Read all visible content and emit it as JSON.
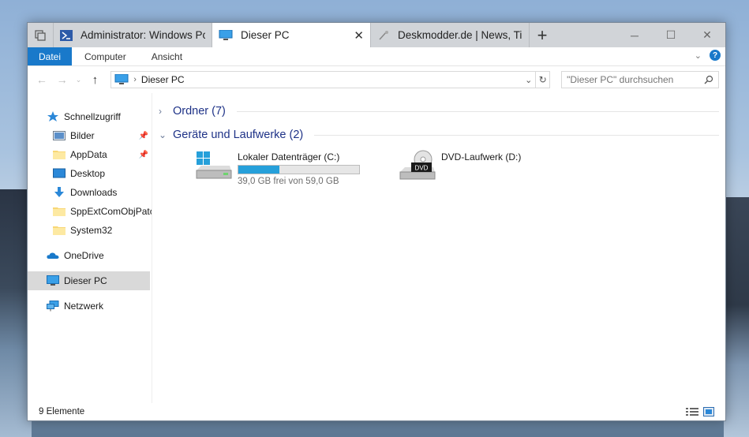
{
  "tabs": [
    {
      "label": "Administrator: Windows Pc",
      "icon": "powershell-icon"
    },
    {
      "label": "Dieser PC",
      "icon": "computer-icon",
      "active": true
    },
    {
      "label": "Deskmodder.de | News, Tip",
      "icon": "edge-icon"
    }
  ],
  "ribbon": {
    "tabs": [
      "Datei",
      "Computer",
      "Ansicht"
    ]
  },
  "address": {
    "path": "Dieser PC",
    "search_placeholder": "\"Dieser PC\" durchsuchen"
  },
  "sidebar": {
    "items": [
      {
        "label": "Schnellzugriff",
        "icon": "star-icon"
      },
      {
        "label": "Bilder",
        "icon": "pictures-icon",
        "pinned": true
      },
      {
        "label": "AppData",
        "icon": "folder-icon",
        "pinned": true
      },
      {
        "label": "Desktop",
        "icon": "desktop-icon"
      },
      {
        "label": "Downloads",
        "icon": "download-icon"
      },
      {
        "label": "SppExtComObjPatc",
        "icon": "folder-icon"
      },
      {
        "label": "System32",
        "icon": "folder-icon"
      },
      {
        "label": "OneDrive",
        "icon": "cloud-icon"
      },
      {
        "label": "Dieser PC",
        "icon": "computer-icon",
        "selected": true
      },
      {
        "label": "Netzwerk",
        "icon": "network-icon"
      }
    ]
  },
  "groups": {
    "folders": "Ordner (7)",
    "devices": "Geräte und Laufwerke (2)"
  },
  "drives": [
    {
      "name": "Lokaler Datenträger (C:)",
      "free_text": "39,0 GB frei von 59,0 GB",
      "used_fraction": 0.339
    },
    {
      "name": "DVD-Laufwerk (D:)",
      "badge": "DVD"
    }
  ],
  "status": {
    "count": "9 Elemente"
  },
  "colors": {
    "accent": "#1979ca",
    "selection": "#d9d9d9",
    "group_header": "#1e3287",
    "drive_bar": "#26a0da"
  }
}
